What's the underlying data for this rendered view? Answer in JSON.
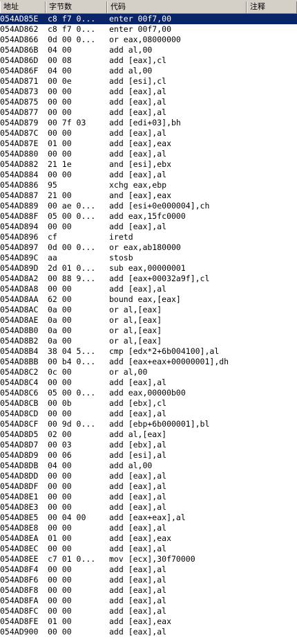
{
  "header": {
    "address": "地址",
    "bytes": "字节数",
    "code": "代码",
    "comment": "注释"
  },
  "rows": [
    {
      "address": "054AD85E",
      "bytes": "c8 f7 0...",
      "code": "enter 00f7,00"
    },
    {
      "address": "054AD862",
      "bytes": "c8 f7 0...",
      "code": "enter 00f7,00"
    },
    {
      "address": "054AD866",
      "bytes": "0d 00 0...",
      "code": "or eax,08000000"
    },
    {
      "address": "054AD86B",
      "bytes": "04 00",
      "code": "add al,00"
    },
    {
      "address": "054AD86D",
      "bytes": "00 08",
      "code": "add [eax],cl"
    },
    {
      "address": "054AD86F",
      "bytes": "04 00",
      "code": "add al,00"
    },
    {
      "address": "054AD871",
      "bytes": "00 0e",
      "code": "add [esi],cl"
    },
    {
      "address": "054AD873",
      "bytes": "00 00",
      "code": "add [eax],al"
    },
    {
      "address": "054AD875",
      "bytes": "00 00",
      "code": "add [eax],al"
    },
    {
      "address": "054AD877",
      "bytes": "00 00",
      "code": "add [eax],al"
    },
    {
      "address": "054AD879",
      "bytes": "00 7f 03",
      "code": "add [edi+03],bh"
    },
    {
      "address": "054AD87C",
      "bytes": "00 00",
      "code": "add [eax],al"
    },
    {
      "address": "054AD87E",
      "bytes": "01 00",
      "code": "add [eax],eax"
    },
    {
      "address": "054AD880",
      "bytes": "00 00",
      "code": "add [eax],al"
    },
    {
      "address": "054AD882",
      "bytes": "21 1e",
      "code": "and [esi],ebx"
    },
    {
      "address": "054AD884",
      "bytes": "00 00",
      "code": "add [eax],al"
    },
    {
      "address": "054AD886",
      "bytes": "95",
      "code": "xchg eax,ebp"
    },
    {
      "address": "054AD887",
      "bytes": "21 00",
      "code": "and [eax],eax"
    },
    {
      "address": "054AD889",
      "bytes": "00 ae 0...",
      "code": "add [esi+0e000004],ch"
    },
    {
      "address": "054AD88F",
      "bytes": "05 00 0...",
      "code": "add eax,15fc0000"
    },
    {
      "address": "054AD894",
      "bytes": "00 00",
      "code": "add [eax],al"
    },
    {
      "address": "054AD896",
      "bytes": "cf",
      "code": "iretd"
    },
    {
      "address": "054AD897",
      "bytes": "0d 00 0...",
      "code": "or eax,ab180000"
    },
    {
      "address": "054AD89C",
      "bytes": "aa",
      "code": "stosb"
    },
    {
      "address": "054AD89D",
      "bytes": "2d 01 0...",
      "code": "sub eax,00000001"
    },
    {
      "address": "054AD8A2",
      "bytes": "00 88 9...",
      "code": "add [eax+00032a9f],cl"
    },
    {
      "address": "054AD8A8",
      "bytes": "00 00",
      "code": "add [eax],al"
    },
    {
      "address": "054AD8AA",
      "bytes": "62 00",
      "code": "bound eax,[eax]"
    },
    {
      "address": "054AD8AC",
      "bytes": "0a 00",
      "code": "or al,[eax]"
    },
    {
      "address": "054AD8AE",
      "bytes": "0a 00",
      "code": "or al,[eax]"
    },
    {
      "address": "054AD8B0",
      "bytes": "0a 00",
      "code": "or al,[eax]"
    },
    {
      "address": "054AD8B2",
      "bytes": "0a 00",
      "code": "or al,[eax]"
    },
    {
      "address": "054AD8B4",
      "bytes": "38 04 5...",
      "code": "cmp [edx*2+6b004100],al"
    },
    {
      "address": "054AD8BB",
      "bytes": "00 b4 0...",
      "code": "add [eax+eax+00000001],dh"
    },
    {
      "address": "054AD8C2",
      "bytes": "0c 00",
      "code": "or al,00"
    },
    {
      "address": "054AD8C4",
      "bytes": "00 00",
      "code": "add [eax],al"
    },
    {
      "address": "054AD8C6",
      "bytes": "05 00 0...",
      "code": "add eax,00000b00"
    },
    {
      "address": "054AD8CB",
      "bytes": "00 0b",
      "code": "add [ebx],cl"
    },
    {
      "address": "054AD8CD",
      "bytes": "00 00",
      "code": "add [eax],al"
    },
    {
      "address": "054AD8CF",
      "bytes": "00 9d 0...",
      "code": "add [ebp+6b000001],bl"
    },
    {
      "address": "054AD8D5",
      "bytes": "02 00",
      "code": "add al,[eax]"
    },
    {
      "address": "054AD8D7",
      "bytes": "00 03",
      "code": "add [ebx],al"
    },
    {
      "address": "054AD8D9",
      "bytes": "00 06",
      "code": "add [esi],al"
    },
    {
      "address": "054AD8DB",
      "bytes": "04 00",
      "code": "add al,00"
    },
    {
      "address": "054AD8DD",
      "bytes": "00 00",
      "code": "add [eax],al"
    },
    {
      "address": "054AD8DF",
      "bytes": "00 00",
      "code": "add [eax],al"
    },
    {
      "address": "054AD8E1",
      "bytes": "00 00",
      "code": "add [eax],al"
    },
    {
      "address": "054AD8E3",
      "bytes": "00 00",
      "code": "add [eax],al"
    },
    {
      "address": "054AD8E5",
      "bytes": "00 04 00",
      "code": "add [eax+eax],al"
    },
    {
      "address": "054AD8E8",
      "bytes": "00 00",
      "code": "add [eax],al"
    },
    {
      "address": "054AD8EA",
      "bytes": "01 00",
      "code": "add [eax],eax"
    },
    {
      "address": "054AD8EC",
      "bytes": "00 00",
      "code": "add [eax],al"
    },
    {
      "address": "054AD8EE",
      "bytes": "c7 01 0...",
      "code": "mov [ecx],30f70000"
    },
    {
      "address": "054AD8F4",
      "bytes": "00 00",
      "code": "add [eax],al"
    },
    {
      "address": "054AD8F6",
      "bytes": "00 00",
      "code": "add [eax],al"
    },
    {
      "address": "054AD8F8",
      "bytes": "00 00",
      "code": "add [eax],al"
    },
    {
      "address": "054AD8FA",
      "bytes": "00 00",
      "code": "add [eax],al"
    },
    {
      "address": "054AD8FC",
      "bytes": "00 00",
      "code": "add [eax],al"
    },
    {
      "address": "054AD8FE",
      "bytes": "01 00",
      "code": "add [eax],eax"
    },
    {
      "address": "054AD900",
      "bytes": "00 00",
      "code": "add [eax],al"
    }
  ],
  "selected_row": 0,
  "colors": {
    "selection_background": "#0a246a",
    "selection_text": "#ffffff",
    "header_background": "#d4d0c8"
  }
}
